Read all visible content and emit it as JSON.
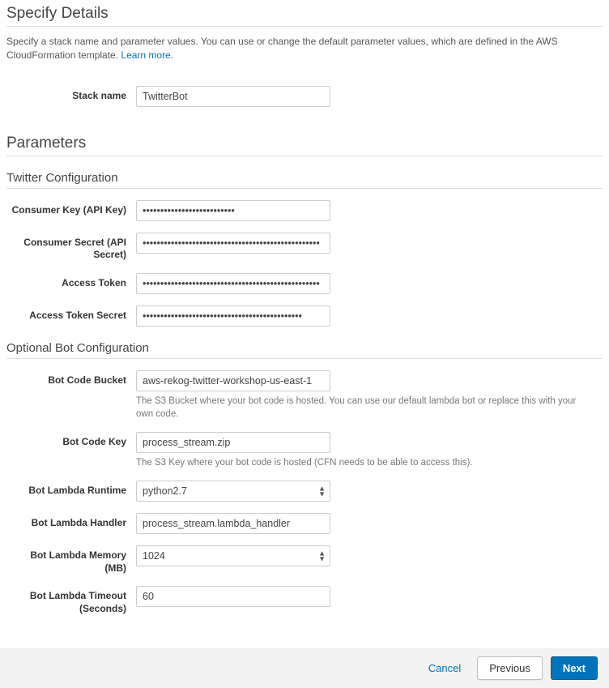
{
  "header": {
    "title": "Specify Details",
    "description_pre": "Specify a stack name and parameter values. You can use or change the default parameter values, which are defined in the AWS CloudFormation template. ",
    "learn_more": "Learn more."
  },
  "stack": {
    "label": "Stack name",
    "value": "TwitterBot"
  },
  "parameters_title": "Parameters",
  "twitter": {
    "title": "Twitter Configuration",
    "consumer_key_label": "Consumer Key (API Key)",
    "consumer_key_value": "••••••••••••••••••••••••••",
    "consumer_secret_label": "Consumer Secret (API Secret)",
    "consumer_secret_value": "••••••••••••••••••••••••••••••••••••••••••••••••••",
    "access_token_label": "Access Token",
    "access_token_value": "••••••••••••••••••••••••••••••••••••••••••••••••••",
    "access_token_secret_label": "Access Token Secret",
    "access_token_secret_value": "•••••••••••••••••••••••••••••••••••••••••••••"
  },
  "bot": {
    "title": "Optional Bot Configuration",
    "bucket_label": "Bot Code Bucket",
    "bucket_value": "aws-rekog-twitter-workshop-us-east-1",
    "bucket_help": "The S3 Bucket where your bot code is hosted. You can use our default lambda bot or replace this with your own code.",
    "key_label": "Bot Code Key",
    "key_value": "process_stream.zip",
    "key_help": "The S3 Key where your bot code is hosted (CFN needs to be able to access this).",
    "runtime_label": "Bot Lambda Runtime",
    "runtime_value": "python2.7",
    "handler_label": "Bot Lambda Handler",
    "handler_value": "process_stream.lambda_handler",
    "memory_label": "Bot Lambda Memory (MB)",
    "memory_value": "1024",
    "timeout_label": "Bot Lambda Timeout (Seconds)",
    "timeout_value": "60"
  },
  "footer": {
    "cancel": "Cancel",
    "previous": "Previous",
    "next": "Next"
  }
}
